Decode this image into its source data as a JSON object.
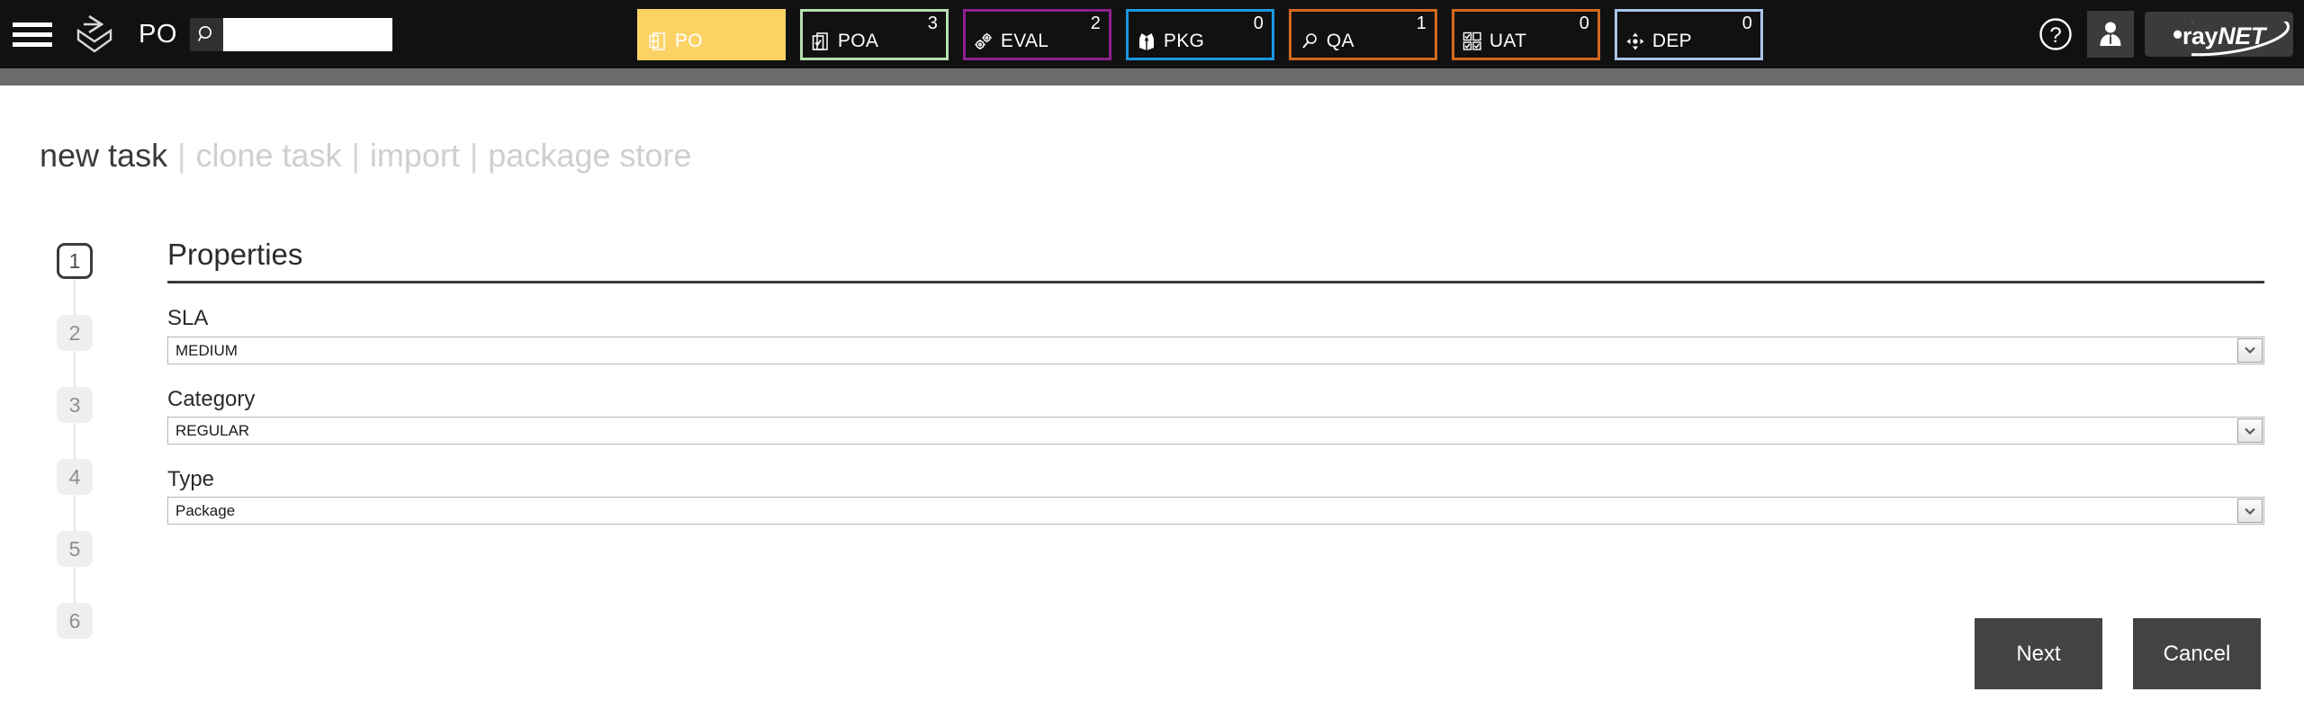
{
  "header": {
    "menu_icon": "hamburger-menu-icon",
    "logo_icon": "raypack-box-logo",
    "context_label": "PO",
    "search": {
      "icon": "search-icon",
      "value": "",
      "placeholder": ""
    },
    "tabs": [
      {
        "label": "PO",
        "count": "",
        "icon": "package-order-icon",
        "color": "#fcd265",
        "active": true
      },
      {
        "label": "POA",
        "count": "3",
        "icon": "checkbox-doc-icon",
        "color": "#b5dfb0",
        "active": false
      },
      {
        "label": "EVAL",
        "count": "2",
        "icon": "gears-icon",
        "color": "#8e1f8e",
        "active": false
      },
      {
        "label": "PKG",
        "count": "0",
        "icon": "open-box-icon",
        "color": "#1b97e0",
        "active": false
      },
      {
        "label": "QA",
        "count": "1",
        "icon": "magnifier-icon",
        "color": "#d2691e",
        "active": false
      },
      {
        "label": "UAT",
        "count": "0",
        "icon": "grid-checks-icon",
        "color": "#d2691e",
        "active": false
      },
      {
        "label": "DEP",
        "count": "0",
        "icon": "deploy-arrows-icon",
        "color": "#a9c5e8",
        "active": false
      }
    ],
    "help_icon": "question-mark-icon",
    "user_icon": "user-avatar-icon",
    "brand": {
      "prefix": "ray",
      "suffix": "NET"
    }
  },
  "breadcrumb": {
    "items": [
      {
        "label": "new task",
        "current": true
      },
      {
        "label": "clone task",
        "current": false
      },
      {
        "label": "import",
        "current": false
      },
      {
        "label": "package store",
        "current": false
      }
    ],
    "separator": "|"
  },
  "stepper": {
    "steps": [
      {
        "label": "1",
        "active": true
      },
      {
        "label": "2",
        "active": false
      },
      {
        "label": "3",
        "active": false
      },
      {
        "label": "4",
        "active": false
      },
      {
        "label": "5",
        "active": false
      },
      {
        "label": "6",
        "active": false
      }
    ]
  },
  "form": {
    "title": "Properties",
    "fields": [
      {
        "label": "SLA",
        "value": "MEDIUM"
      },
      {
        "label": "Category",
        "value": "REGULAR"
      },
      {
        "label": "Type",
        "value": "Package"
      }
    ]
  },
  "actions": {
    "next": "Next",
    "cancel": "Cancel"
  }
}
